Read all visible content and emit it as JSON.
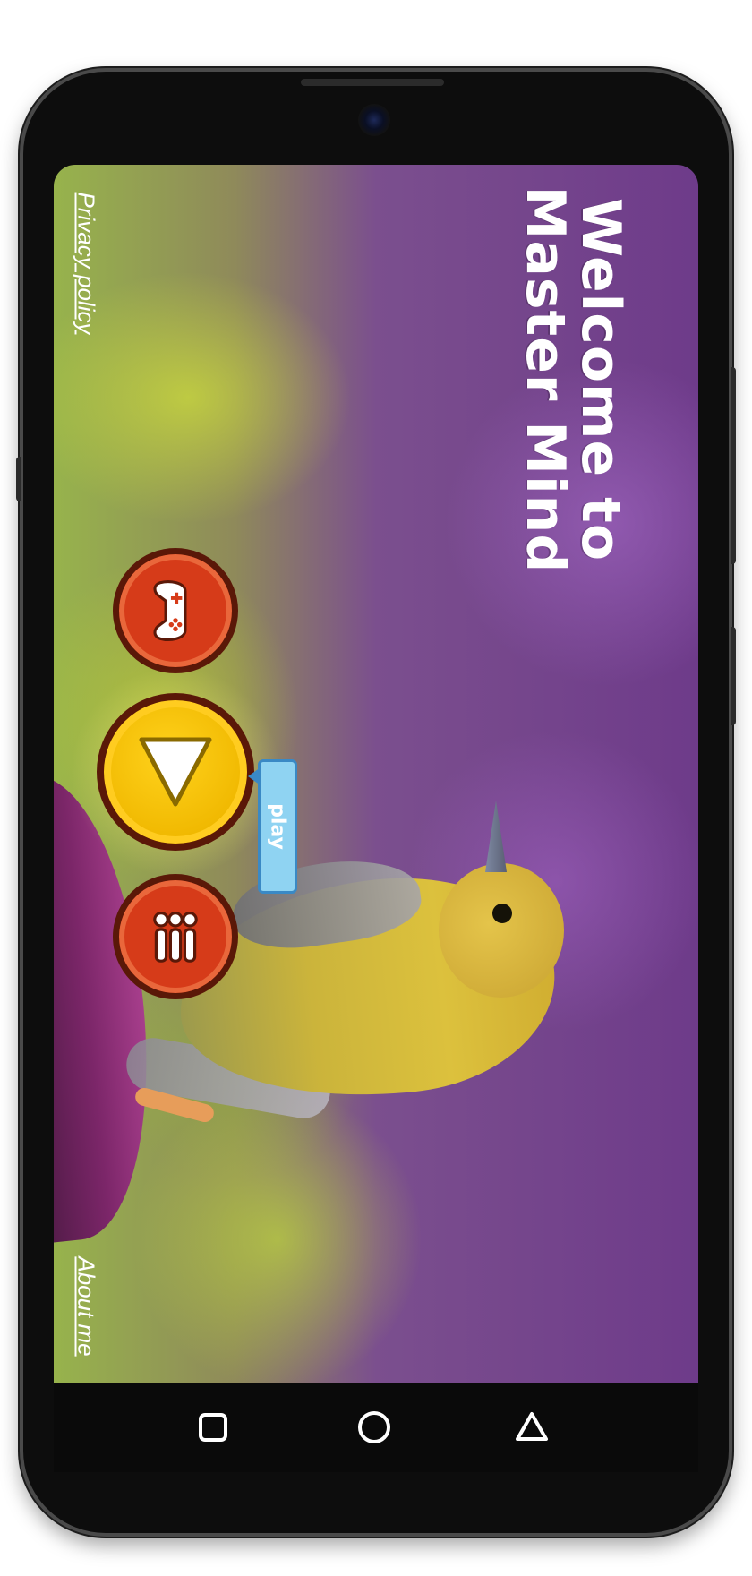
{
  "app": {
    "title_line1": "Welcome to",
    "title_line2": "Master Mind"
  },
  "links": {
    "privacy": "Privacy policy",
    "about": "About me"
  },
  "buttons": {
    "play_tooltip": "play",
    "games_icon": "gamepad-icon",
    "play_icon": "play-triangle-icon",
    "menu_icon": "three-bars-icon"
  },
  "navbar": {
    "items": [
      "recent-apps-icon",
      "home-icon",
      "back-icon"
    ]
  },
  "colors": {
    "button_red": "#d63b19",
    "button_yellow": "#f0b800",
    "tooltip_blue": "#8fd3f2",
    "title_text": "#ffffff"
  }
}
